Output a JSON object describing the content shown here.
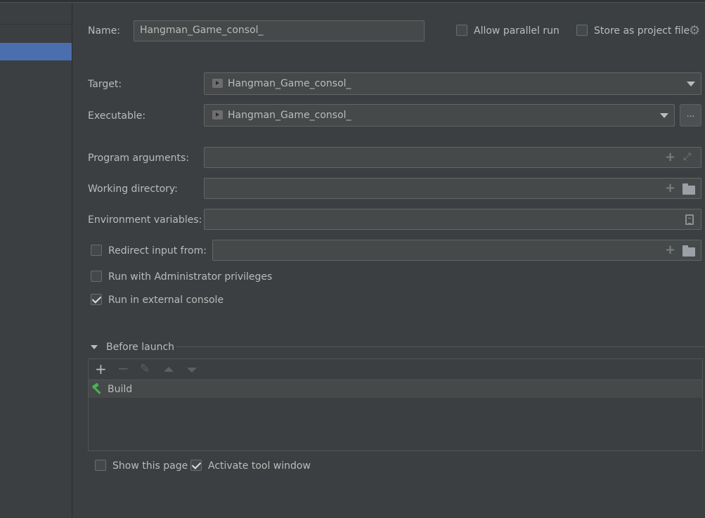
{
  "name_field": {
    "label": "Name:",
    "value": "Hangman_Game_consol_"
  },
  "allow_parallel": {
    "label": "Allow parallel run",
    "checked": false
  },
  "store_project": {
    "label": "Store as project file",
    "checked": false
  },
  "target": {
    "label": "Target:",
    "value": "Hangman_Game_consol_"
  },
  "executable": {
    "label": "Executable:",
    "value": "Hangman_Game_consol_",
    "browse_label": "..."
  },
  "program_arguments": {
    "label": "Program arguments:",
    "value": ""
  },
  "working_directory": {
    "label": "Working directory:",
    "value": ""
  },
  "environment_variables": {
    "label": "Environment variables:",
    "value": ""
  },
  "redirect_input": {
    "label": "Redirect input from:",
    "checked": false,
    "value": ""
  },
  "run_admin": {
    "label": "Run with Administrator privileges",
    "checked": false
  },
  "run_external": {
    "label": "Run in external console",
    "checked": true
  },
  "before_launch": {
    "title": "Before launch",
    "items": [
      {
        "label": "Build",
        "icon": "hammer-icon"
      }
    ]
  },
  "show_page": {
    "label": "Show this page",
    "checked": false
  },
  "activate_tool": {
    "label": "Activate tool window",
    "checked": true
  },
  "colors": {
    "selection": "#4b6eaf",
    "background": "#3c3f41",
    "field": "#45494a",
    "build_icon": "#4caf50"
  }
}
